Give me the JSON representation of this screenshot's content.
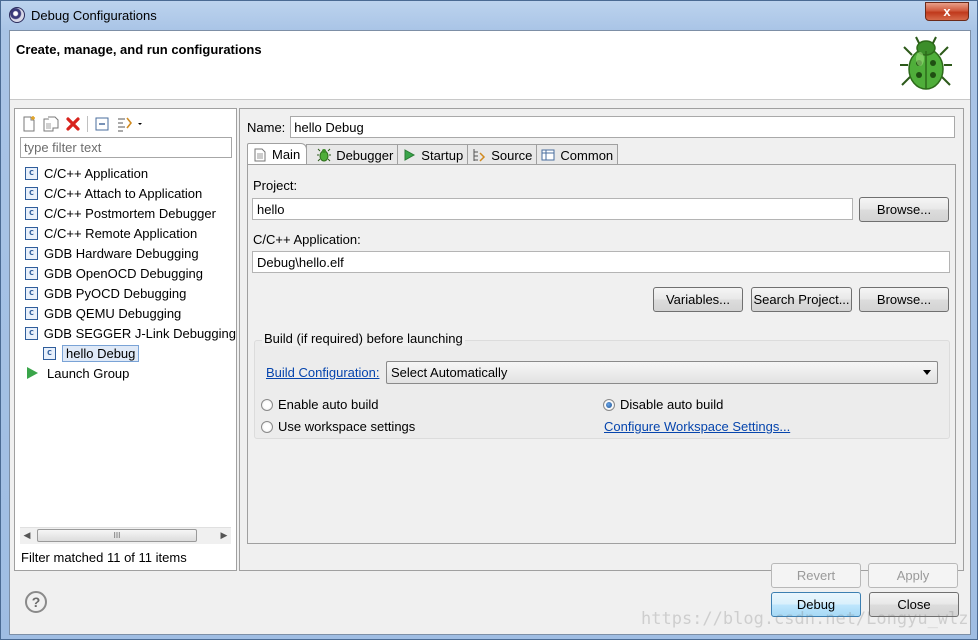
{
  "window": {
    "title": "Debug Configurations",
    "close_glyph": "x"
  },
  "header": {
    "heading": "Create, manage, and run configurations"
  },
  "left": {
    "toolbar": [
      "new-config-icon",
      "duplicate-icon",
      "delete-icon",
      "collapse-all-icon",
      "filter-icon",
      "dropdown-icon"
    ],
    "filter_placeholder": "type filter text",
    "filter_value": "",
    "items": [
      {
        "label": "C/C++ Application",
        "icon": "c-config-icon"
      },
      {
        "label": "C/C++ Attach to Application",
        "icon": "c-config-icon"
      },
      {
        "label": "C/C++ Postmortem Debugger",
        "icon": "c-config-icon"
      },
      {
        "label": "C/C++ Remote Application",
        "icon": "c-config-icon"
      },
      {
        "label": "GDB Hardware Debugging",
        "icon": "c-config-icon"
      },
      {
        "label": "GDB OpenOCD Debugging",
        "icon": "c-config-icon"
      },
      {
        "label": "GDB PyOCD Debugging",
        "icon": "c-config-icon"
      },
      {
        "label": "GDB QEMU Debugging",
        "icon": "c-config-icon"
      },
      {
        "label": "GDB SEGGER J-Link Debugging",
        "icon": "c-config-icon"
      },
      {
        "label": "hello Debug",
        "icon": "c-config-icon",
        "selected": true,
        "child": true
      },
      {
        "label": "Launch Group",
        "icon": "launch-group-icon"
      }
    ],
    "scroll_thumb_glyph": "III",
    "status": "Filter matched 11 of 11 items"
  },
  "right": {
    "name_label": "Name:",
    "name_value": "hello Debug",
    "tabs": [
      {
        "label": "Main",
        "icon": "main-tab-icon",
        "active": true
      },
      {
        "label": "Debugger",
        "icon": "debugger-tab-icon"
      },
      {
        "label": "Startup",
        "icon": "startup-tab-icon"
      },
      {
        "label": "Source",
        "icon": "source-tab-icon"
      },
      {
        "label": "Common",
        "icon": "common-tab-icon"
      }
    ],
    "project_label": "Project:",
    "project_value": "hello",
    "browse_label": "Browse...",
    "app_label": "C/C++ Application:",
    "app_value": "Debug\\hello.elf",
    "variables_label": "Variables...",
    "search_project_label": "Search Project...",
    "browse2_label": "Browse...",
    "build_group_title": "Build (if required) before launching",
    "build_config_link": "Build Configuration:",
    "build_config_value": "Select Automatically",
    "enable_auto_build": "Enable auto build",
    "disable_auto_build": "Disable auto build",
    "use_workspace": "Use workspace settings",
    "configure_workspace_link": "Configure Workspace Settings...",
    "revert_label": "Revert",
    "apply_label": "Apply"
  },
  "footer": {
    "help_glyph": "?",
    "debug_label": "Debug",
    "close_label": "Close",
    "watermark": "https://blog.csdn.net/Longyu_wlz"
  },
  "colors": {
    "accent": "#3c7fb1",
    "link": "#0645ad",
    "play": "#3aa54a",
    "delete": "#d8231d"
  }
}
